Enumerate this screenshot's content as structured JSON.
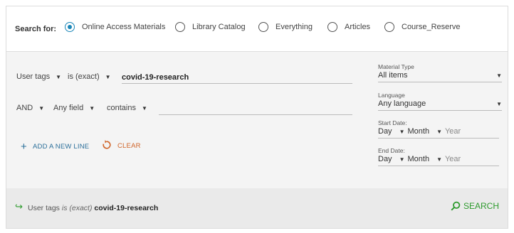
{
  "scope": {
    "label": "Search for:",
    "options": [
      {
        "label": "Online Access Materials",
        "selected": true
      },
      {
        "label": "Library Catalog",
        "selected": false
      },
      {
        "label": "Everything",
        "selected": false
      },
      {
        "label": "Articles",
        "selected": false
      },
      {
        "label": "Course_Reserve",
        "selected": false
      }
    ]
  },
  "lines": [
    {
      "field": "User tags",
      "precision": "is (exact)",
      "value": "covid-19-research"
    },
    {
      "operator": "AND",
      "field": "Any field",
      "precision": "contains",
      "value": ""
    }
  ],
  "actions": {
    "add_line": "ADD A NEW LINE",
    "clear": "CLEAR"
  },
  "facets": {
    "material_type": {
      "label": "Material Type",
      "value": "All items"
    },
    "language": {
      "label": "Language",
      "value": "Any language"
    },
    "start_date": {
      "label": "Start Date:",
      "day": "Day",
      "month": "Month",
      "year_placeholder": "Year"
    },
    "end_date": {
      "label": "End Date:",
      "day": "Day",
      "month": "Month",
      "year_placeholder": "Year"
    }
  },
  "summary": {
    "field": "User tags",
    "precision": "is (exact)",
    "value": "covid-19-research"
  },
  "search_button": "SEARCH",
  "colors": {
    "accent_blue": "#1a86b8",
    "search_green": "#2e9b2e",
    "clear_orange": "#d0652a"
  }
}
